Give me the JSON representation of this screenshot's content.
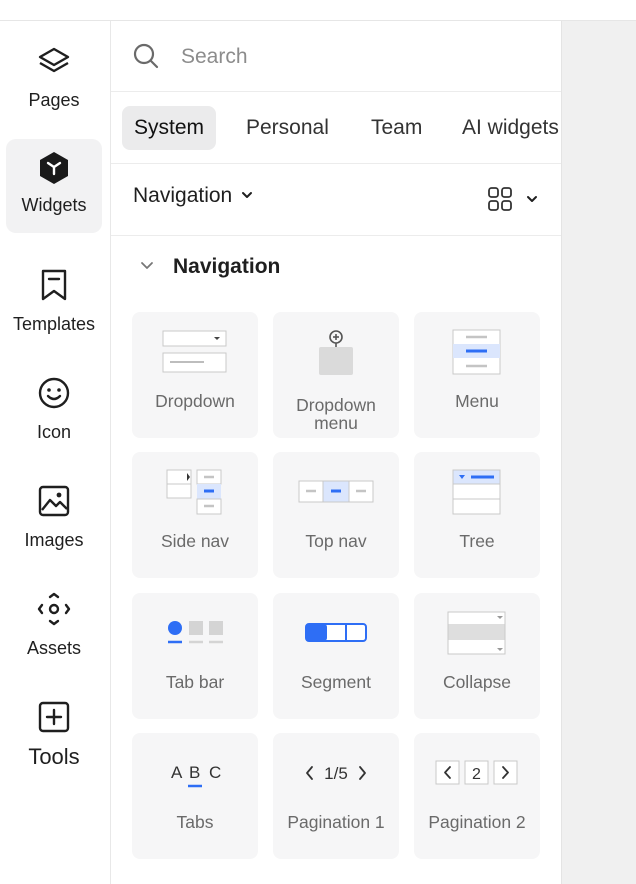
{
  "rail": {
    "items": [
      {
        "label": "Pages",
        "icon": "layers-icon"
      },
      {
        "label": "Widgets",
        "icon": "widgets-icon",
        "active": true
      },
      {
        "label": "Templates",
        "icon": "bookmark-icon"
      },
      {
        "label": "Icon",
        "icon": "smiley-icon"
      },
      {
        "label": "Images",
        "icon": "image-icon"
      },
      {
        "label": "Assets",
        "icon": "assets-icon"
      },
      {
        "label": "Tools",
        "icon": "plus-square-icon"
      }
    ]
  },
  "search": {
    "placeholder": "Search",
    "value": ""
  },
  "tabs": [
    {
      "label": "System",
      "active": true
    },
    {
      "label": "Personal"
    },
    {
      "label": "Team"
    },
    {
      "label": "AI widgets"
    }
  ],
  "category": {
    "selected": "Navigation"
  },
  "section": {
    "title": "Navigation"
  },
  "widgets": [
    {
      "label": "Dropdown",
      "icon": "dropdown-widget-icon"
    },
    {
      "label": "Dropdown menu",
      "icon": "dropdown-menu-widget-icon"
    },
    {
      "label": "Menu",
      "icon": "menu-widget-icon"
    },
    {
      "label": "Side nav",
      "icon": "side-nav-widget-icon"
    },
    {
      "label": "Top nav",
      "icon": "top-nav-widget-icon"
    },
    {
      "label": "Tree",
      "icon": "tree-widget-icon"
    },
    {
      "label": "Tab bar",
      "icon": "tab-bar-widget-icon"
    },
    {
      "label": "Segment",
      "icon": "segment-widget-icon"
    },
    {
      "label": "Collapse",
      "icon": "collapse-widget-icon"
    },
    {
      "label": "Tabs",
      "icon": "tabs-widget-icon"
    },
    {
      "label": "Pagination 1",
      "icon": "pagination1-widget-icon"
    },
    {
      "label": "Pagination 2",
      "icon": "pagination2-widget-icon"
    }
  ],
  "widget_icon_text": {
    "tabs_abc": [
      "A",
      "B",
      "C"
    ],
    "pagination1": "1/5",
    "pagination2": "2"
  },
  "colors": {
    "accent": "#2e6ef5",
    "card_bg": "#f6f6f7",
    "active_bg": "#f2f2f3"
  }
}
